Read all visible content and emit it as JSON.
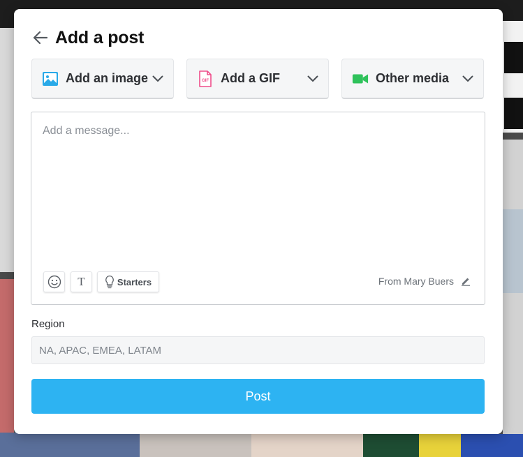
{
  "dialog": {
    "title": "Add a post",
    "back_icon": "arrow-left-icon"
  },
  "media_buttons": [
    {
      "label": "Add an image",
      "icon": "image-icon",
      "icon_color": "#29a9e8"
    },
    {
      "label": "Add a GIF",
      "icon": "gif-file-icon",
      "icon_color": "#ef4e8b"
    },
    {
      "label": "Other media",
      "icon": "video-camera-icon",
      "icon_color": "#2fc25b"
    }
  ],
  "message": {
    "placeholder": "Add a message...",
    "value": ""
  },
  "toolbar": {
    "emoji_icon": "smiley-icon",
    "text_icon": "text-format-icon",
    "starters_label": "Starters",
    "starters_icon": "lightbulb-icon"
  },
  "author": {
    "from_text": "From Mary Buers",
    "edit_icon": "pencil-icon"
  },
  "region": {
    "label": "Region",
    "placeholder": "NA, APAC, EMEA, LATAM",
    "value": ""
  },
  "actions": {
    "post_label": "Post"
  },
  "colors": {
    "accent": "#2db3f2",
    "image_icon": "#29a9e8",
    "gif_icon": "#ef4e8b",
    "video_icon": "#2fc25b"
  }
}
